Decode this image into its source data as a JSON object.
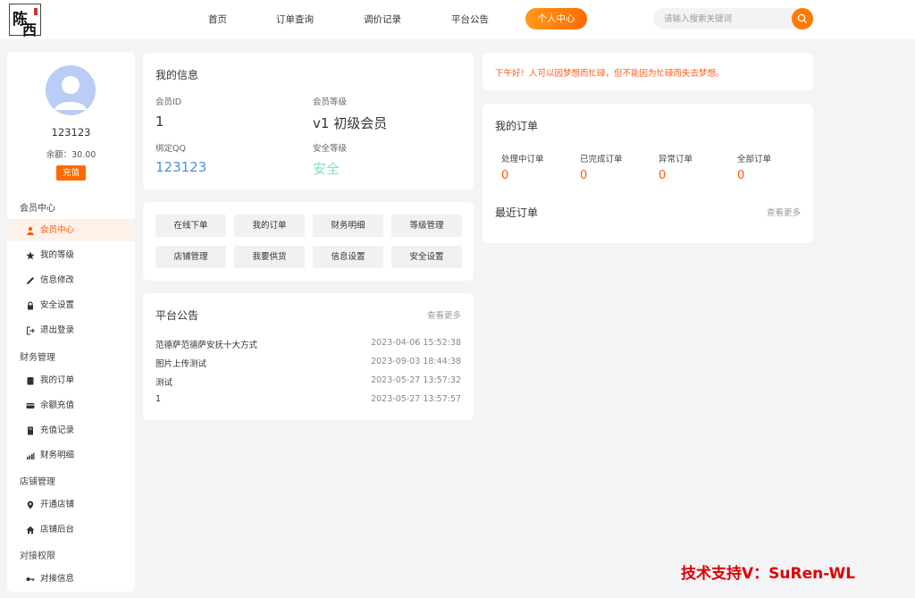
{
  "brand": {
    "logo_text": "陈西"
  },
  "nav": {
    "items": [
      "首页",
      "订单查询",
      "调价记录",
      "平台公告"
    ],
    "active": "个人中心",
    "search_placeholder": "请输入搜索关键词"
  },
  "sidebar": {
    "username": "123123",
    "balance": "余额：30.00",
    "recharge_label": "充值",
    "sections": [
      {
        "title": "会员中心",
        "items": [
          {
            "label": "会员中心",
            "icon": "user-icon",
            "active": true
          },
          {
            "label": "我的等级",
            "icon": "star-icon"
          },
          {
            "label": "信息修改",
            "icon": "pencil-icon"
          },
          {
            "label": "安全设置",
            "icon": "lock-icon"
          },
          {
            "label": "退出登录",
            "icon": "logout-icon"
          }
        ]
      },
      {
        "title": "财务管理",
        "items": [
          {
            "label": "我的订单",
            "icon": "clipboard-icon"
          },
          {
            "label": "余额充值",
            "icon": "card-icon"
          },
          {
            "label": "充值记录",
            "icon": "receipt-icon"
          },
          {
            "label": "财务明细",
            "icon": "bar-chart-icon"
          }
        ]
      },
      {
        "title": "店铺管理",
        "items": [
          {
            "label": "开通店铺",
            "icon": "location-pin-icon"
          },
          {
            "label": "店铺后台",
            "icon": "home-icon"
          }
        ]
      },
      {
        "title": "对接权限",
        "items": [
          {
            "label": "对接信息",
            "icon": "key-icon"
          }
        ]
      }
    ]
  },
  "my_info": {
    "title": "我的信息",
    "fields": {
      "member_id_label": "会员ID",
      "member_id": "1",
      "member_level_label": "会员等级",
      "member_level": "v1 初级会员",
      "qq_label": "绑定QQ",
      "qq": "123123",
      "security_label": "安全等级",
      "security": "安全"
    }
  },
  "quick_buttons": [
    "在线下单",
    "我的订单",
    "财务明细",
    "等级管理",
    "店铺管理",
    "我要供货",
    "信息设置",
    "安全设置"
  ],
  "notices": {
    "title": "平台公告",
    "more": "查看更多",
    "rows": [
      {
        "title": "范德萨范德萨安抚十大方式",
        "date": "2023-04-06 15:52:38"
      },
      {
        "title": "图片上传测试",
        "date": "2023-09-03 18:44:38"
      },
      {
        "title": "测试",
        "date": "2023-05-27 13:57:32"
      },
      {
        "title": "1",
        "date": "2023-05-27 13:57:57"
      }
    ]
  },
  "greeting": "下午好！人可以因梦想而忙碌，但不能因为忙碌而失去梦想。",
  "orders": {
    "title": "我的订单",
    "stats": [
      {
        "label": "处理中订单",
        "value": "0"
      },
      {
        "label": "已完成订单",
        "value": "0"
      },
      {
        "label": "异常订单",
        "value": "0"
      },
      {
        "label": "全部订单",
        "value": "0"
      }
    ],
    "recent_title": "最近订单",
    "more": "查看更多"
  },
  "watermark": "技术支持V：SuRen-WL",
  "colors": {
    "accent": "#ff6a00",
    "qq_blue": "#4a90e2",
    "security_green": "#7ee0c0",
    "greeting_red": "#ff5a1a",
    "watermark_red": "#e00000"
  }
}
